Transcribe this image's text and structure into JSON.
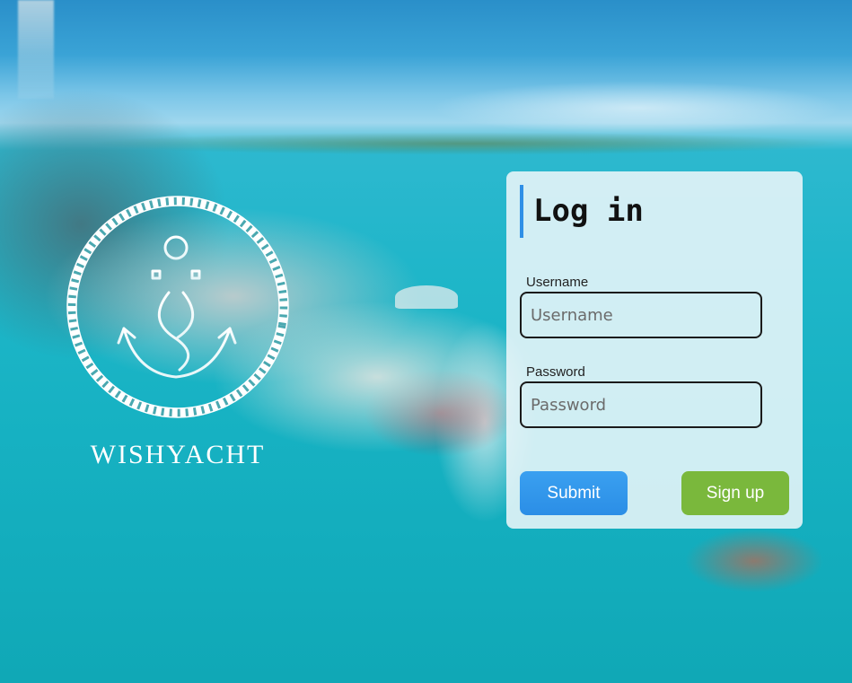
{
  "brand": {
    "name": "WISHYACHT",
    "logo_icon": "anchor-rope-icon"
  },
  "login": {
    "title": "Log in",
    "username": {
      "label": "Username",
      "placeholder": "Username",
      "value": ""
    },
    "password": {
      "label": "Password",
      "placeholder": "Password",
      "value": ""
    },
    "submit_label": "Submit",
    "signup_label": "Sign up"
  },
  "colors": {
    "accent": "#2f8fe6",
    "submit": "#2b8ee6",
    "signup": "#7ab83c"
  }
}
